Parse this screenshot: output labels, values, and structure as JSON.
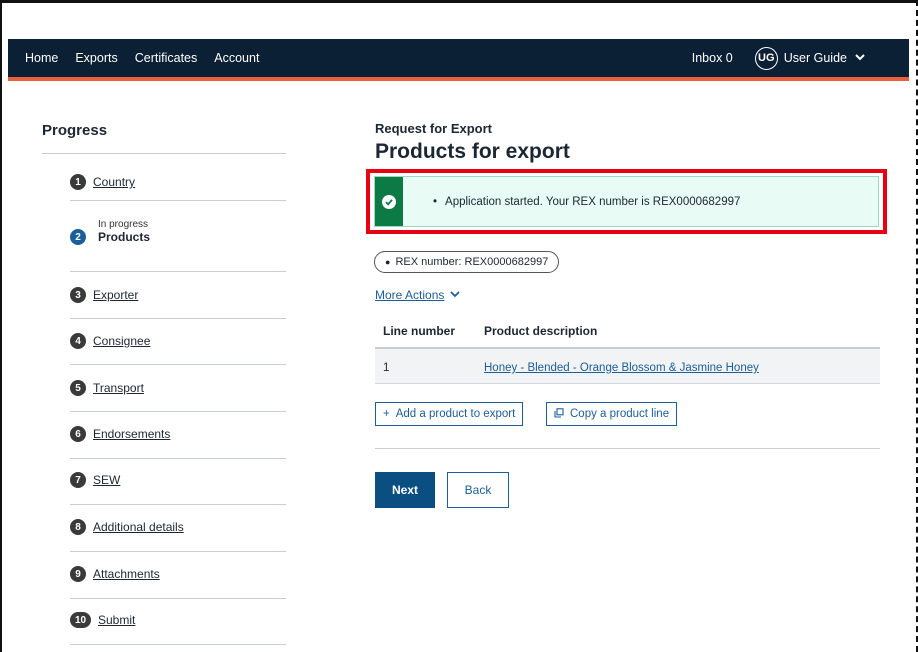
{
  "nav": {
    "links": [
      "Home",
      "Exports",
      "Certificates",
      "Account"
    ],
    "inbox_label": "Inbox 0",
    "user_initials": "UG",
    "user_name": "User Guide"
  },
  "sidebar": {
    "title": "Progress",
    "current_status": "In progress",
    "steps": [
      {
        "num": "1",
        "label": "Country"
      },
      {
        "num": "2",
        "label": "Products"
      },
      {
        "num": "3",
        "label": "Exporter"
      },
      {
        "num": "4",
        "label": "Consignee"
      },
      {
        "num": "5",
        "label": "Transport"
      },
      {
        "num": "6",
        "label": "Endorsements"
      },
      {
        "num": "7",
        "label": "SEW"
      },
      {
        "num": "8",
        "label": "Additional details"
      },
      {
        "num": "9",
        "label": "Attachments"
      },
      {
        "num": "10",
        "label": "Submit"
      }
    ]
  },
  "main": {
    "section_label": "Request for Export",
    "title": "Products for export",
    "alert_message": "Application started. Your REX number is REX0000682997",
    "rex_badge": "REX number: REX0000682997",
    "more_actions": "More Actions",
    "table": {
      "headers": [
        "Line number",
        "Product description"
      ],
      "rows": [
        {
          "line": "1",
          "description": "Honey - Blended - Orange Blossom & Jasmine Honey"
        }
      ]
    },
    "add_product_label": "Add a product to export",
    "copy_line_label": "Copy a product line",
    "next_label": "Next",
    "back_label": "Back"
  },
  "colors": {
    "nav_bg": "#0b1f35",
    "nav_accent": "#e8613c",
    "primary": "#0b4f82",
    "link": "#1b5e9a",
    "success": "#0b7a44",
    "highlight": "#e60012"
  }
}
